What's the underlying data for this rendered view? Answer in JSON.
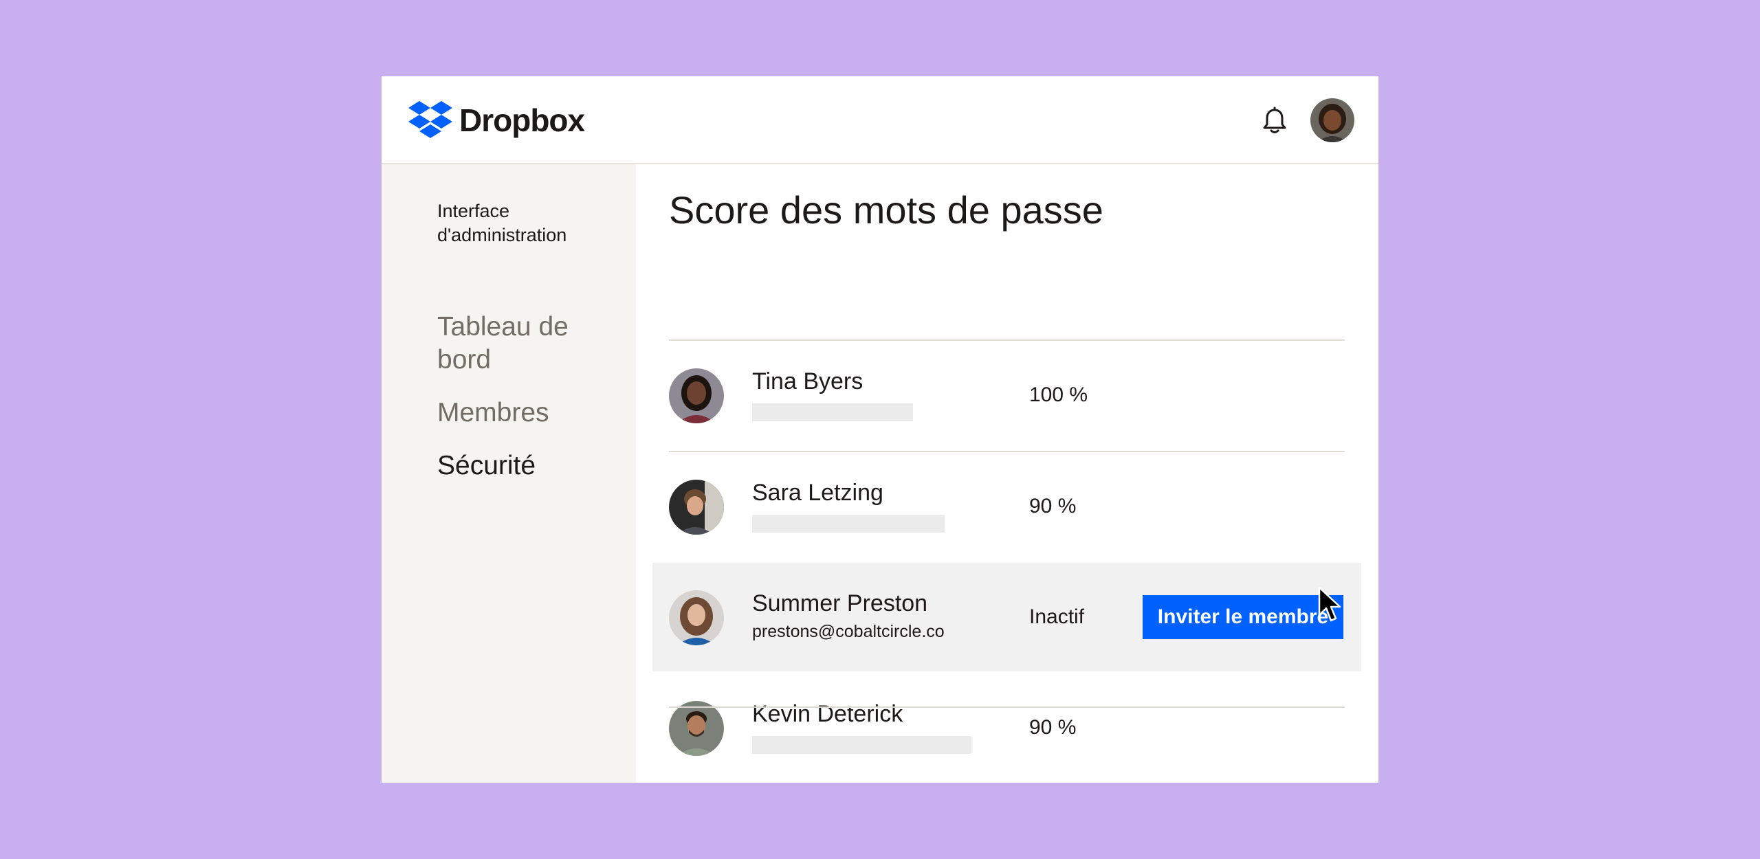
{
  "header": {
    "logo_text": "Dropbox",
    "logo_color": "#0061fe"
  },
  "sidebar": {
    "admin_label": "Interface d'administration",
    "items": [
      {
        "label": "Tableau de bord",
        "active": false
      },
      {
        "label": "Membres",
        "active": false
      },
      {
        "label": "Sécurité",
        "active": true
      }
    ]
  },
  "main": {
    "title": "Score des mots de passe",
    "rows": [
      {
        "name": "Tina Byers",
        "score": "100 %"
      },
      {
        "name": "Sara Letzing",
        "score": "90 %"
      },
      {
        "name": "Summer Preston",
        "email": "prestons@cobaltcircle.co",
        "status": "Inactif",
        "action_label": "Inviter le membre"
      },
      {
        "name": "Kevin Deterick",
        "score": "90 %"
      }
    ]
  },
  "colors": {
    "background": "#c8aff0",
    "accent": "#0061fe",
    "sidebar": "#f5f4f1"
  }
}
